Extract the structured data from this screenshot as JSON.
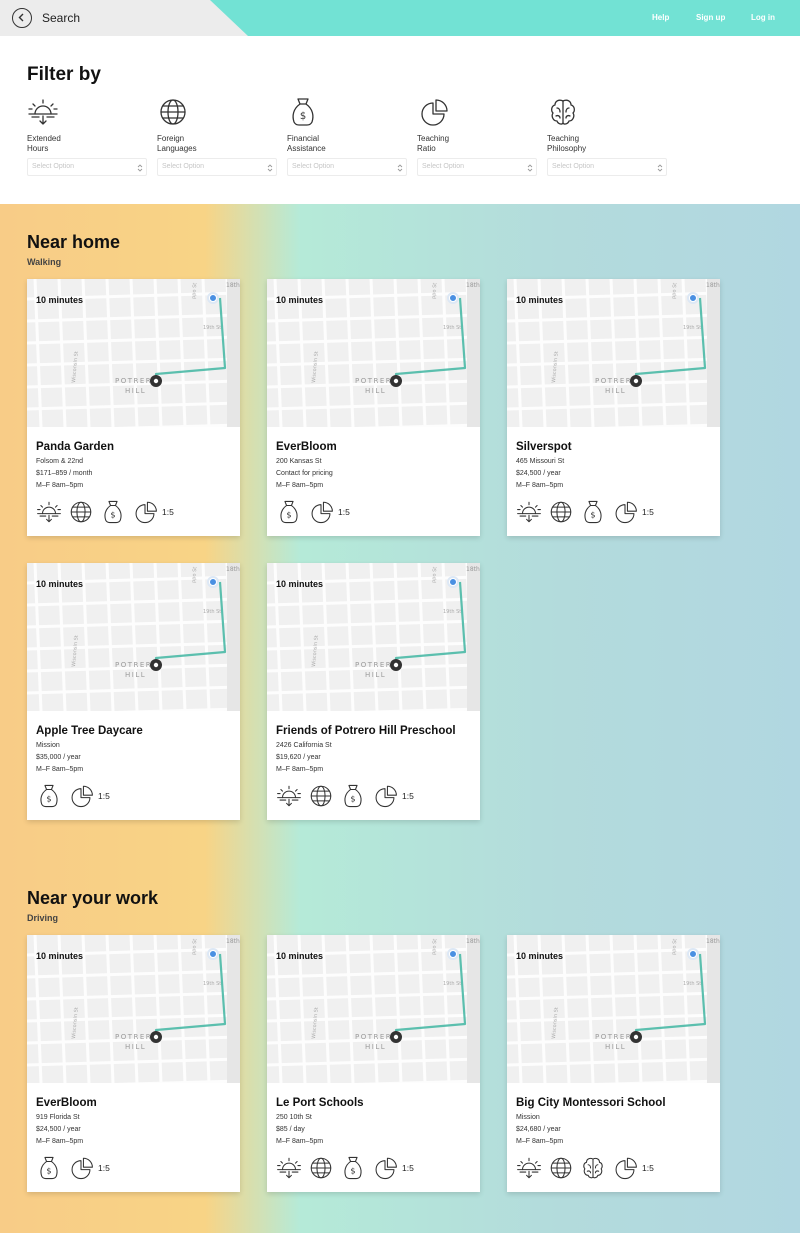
{
  "topbar": {
    "search_label": "Search",
    "links": [
      {
        "label": "Help"
      },
      {
        "label": "Sign up"
      },
      {
        "label": "Log in"
      }
    ]
  },
  "filter": {
    "title": "Filter by",
    "placeholder": "Select Option",
    "items": [
      {
        "label": "Extended\nHours",
        "icon": "sunrise-icon"
      },
      {
        "label": "Foreign\nLanguages",
        "icon": "globe-icon"
      },
      {
        "label": "Financial\nAssistance",
        "icon": "money-bag-icon"
      },
      {
        "label": "Teaching\nRatio",
        "icon": "pie-chart-icon"
      },
      {
        "label": "Teaching\nPhilosophy",
        "icon": "brain-icon"
      }
    ]
  },
  "map_labels": {
    "street_a": "18th",
    "street_b": "19th St",
    "street_c": "Wisconsin St",
    "street_d": "ppo St",
    "area_1": "POTRERO",
    "area_2": "HILL"
  },
  "sections": [
    {
      "title": "Near home",
      "subtitle": "Walking",
      "cards": [
        {
          "minutes": "10 minutes",
          "name": "Panda Garden",
          "address": "Folsom & 22nd",
          "price": "$171–859 / month",
          "hours": "M–F 8am–5pm",
          "features": [
            "sunrise-icon",
            "globe-icon",
            "money-bag-icon",
            "pie-chart-icon"
          ],
          "ratio": "1:5"
        },
        {
          "minutes": "10 minutes",
          "name": "EverBloom",
          "address": "200 Kansas St",
          "price": "Contact for pricing",
          "hours": "M–F 8am–5pm",
          "features": [
            "money-bag-icon",
            "pie-chart-icon"
          ],
          "ratio": "1:5"
        },
        {
          "minutes": "10 minutes",
          "name": "Silverspot",
          "address": "465 Missouri St",
          "price": "$24,500 / year",
          "hours": "M–F 8am–5pm",
          "features": [
            "sunrise-icon",
            "globe-icon",
            "money-bag-icon",
            "pie-chart-icon"
          ],
          "ratio": "1:5"
        },
        {
          "minutes": "10 minutes",
          "name": "Apple Tree Daycare",
          "address": "Mission",
          "price": "$35,000 / year",
          "hours": "M–F 8am–5pm",
          "features": [
            "money-bag-icon",
            "pie-chart-icon"
          ],
          "ratio": "1:5"
        },
        {
          "minutes": "10 minutes",
          "name": "Friends of Potrero Hill Preschool",
          "address": "2426 California St",
          "price": "$19,620 / year",
          "hours": "M–F 8am–5pm",
          "features": [
            "sunrise-icon",
            "globe-icon",
            "money-bag-icon",
            "pie-chart-icon"
          ],
          "ratio": "1:5"
        }
      ]
    },
    {
      "title": "Near your work",
      "subtitle": "Driving",
      "cards": [
        {
          "minutes": "10 minutes",
          "name": "EverBloom",
          "address": "919 Florida St",
          "price": "$24,500 / year",
          "hours": "M–F 8am–5pm",
          "features": [
            "money-bag-icon",
            "pie-chart-icon"
          ],
          "ratio": "1:5"
        },
        {
          "minutes": "10 minutes",
          "name": "Le Port Schools",
          "address": "250 10th St",
          "price": "$85 / day",
          "hours": "M–F 8am–5pm",
          "features": [
            "sunrise-icon",
            "globe-icon",
            "money-bag-icon",
            "pie-chart-icon"
          ],
          "ratio": "1:5"
        },
        {
          "minutes": "10 minutes",
          "name": "Big City Montessori School",
          "address": "Mission",
          "price": "$24,680 / year",
          "hours": "M–F 8am–5pm",
          "features": [
            "sunrise-icon",
            "globe-icon",
            "brain-icon",
            "pie-chart-icon"
          ],
          "ratio": "1:5"
        }
      ]
    }
  ],
  "colors": {
    "topbar": "#72e2d4",
    "route": "#5bbfae",
    "pin": "#4a90e2"
  }
}
